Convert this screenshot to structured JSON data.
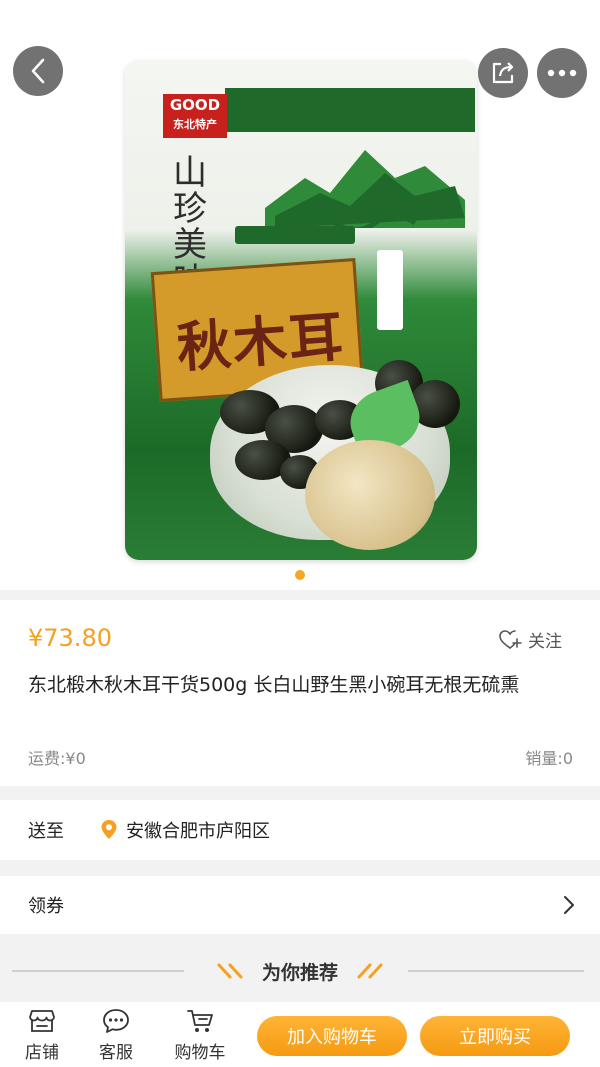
{
  "top_buttons": {
    "back_icon": "chevron-left-icon",
    "share_icon": "share-icon",
    "more_icon": "more-icon"
  },
  "product_image": {
    "packaging_text": {
      "badge": "GOOD",
      "badge_sub": "东北特产",
      "brand_vertical": "山珍美味",
      "sign": "秋木耳"
    },
    "carousel": {
      "count": 1,
      "active": 0
    }
  },
  "product": {
    "price": "¥73.80",
    "follow_label": "关注",
    "title": "东北椴木秋木耳干货500g 长白山野生黑小碗耳无根无硫熏",
    "shipping": "运费:¥0",
    "sales": "销量:0"
  },
  "delivery": {
    "label": "送至",
    "address": "安徽合肥市庐阳区"
  },
  "coupon": {
    "label": "领券"
  },
  "recommend": {
    "title": "为你推荐"
  },
  "bottom_bar": {
    "tabs": [
      {
        "label": "店铺",
        "icon": "store-icon"
      },
      {
        "label": "客服",
        "icon": "chat-icon"
      },
      {
        "label": "购物车",
        "icon": "cart-icon"
      }
    ],
    "add_to_cart": "加入购物车",
    "buy_now": "立即购买"
  },
  "colors": {
    "accent": "#f5a020",
    "button": "#f59a12"
  }
}
